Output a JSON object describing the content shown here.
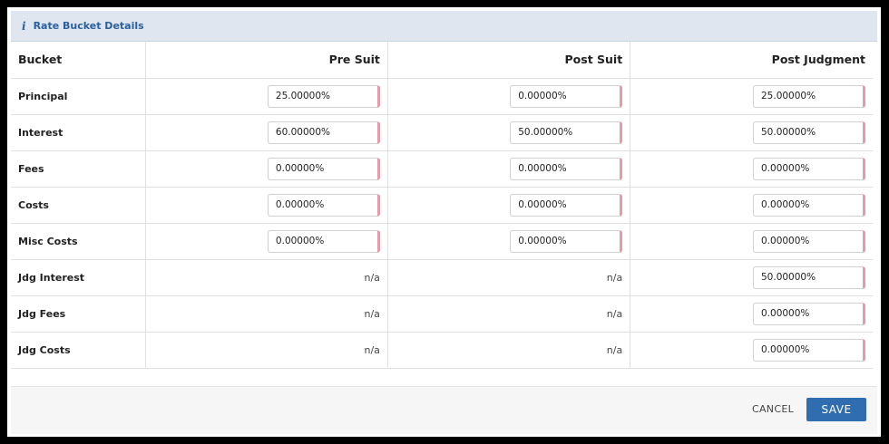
{
  "panel": {
    "icon": "info-icon",
    "info_glyph": "i",
    "title": "Rate Bucket Details"
  },
  "table": {
    "headers": [
      "Bucket",
      "Pre Suit",
      "Post Suit",
      "Post Judgment"
    ],
    "rows": [
      {
        "label": "Principal",
        "cells": [
          "25.00000%",
          "0.00000%",
          "25.00000%"
        ]
      },
      {
        "label": "Interest",
        "cells": [
          "60.00000%",
          "50.00000%",
          "50.00000%"
        ]
      },
      {
        "label": "Fees",
        "cells": [
          "0.00000%",
          "0.00000%",
          "0.00000%"
        ]
      },
      {
        "label": "Costs",
        "cells": [
          "0.00000%",
          "0.00000%",
          "0.00000%"
        ]
      },
      {
        "label": "Misc Costs",
        "cells": [
          "0.00000%",
          "0.00000%",
          "0.00000%"
        ]
      },
      {
        "label": "Jdg Interest",
        "cells": [
          "n/a",
          "n/a",
          "50.00000%"
        ]
      },
      {
        "label": "Jdg Fees",
        "cells": [
          "n/a",
          "n/a",
          "0.00000%"
        ]
      },
      {
        "label": "Jdg Costs",
        "cells": [
          "n/a",
          "n/a",
          "0.00000%"
        ]
      }
    ]
  },
  "footer": {
    "cancel_label": "CANCEL",
    "save_label": "SAVE"
  },
  "colors": {
    "accent": "#2f6db0",
    "header_bg": "#dfe6ef",
    "input_marker": "#e79aa8"
  }
}
